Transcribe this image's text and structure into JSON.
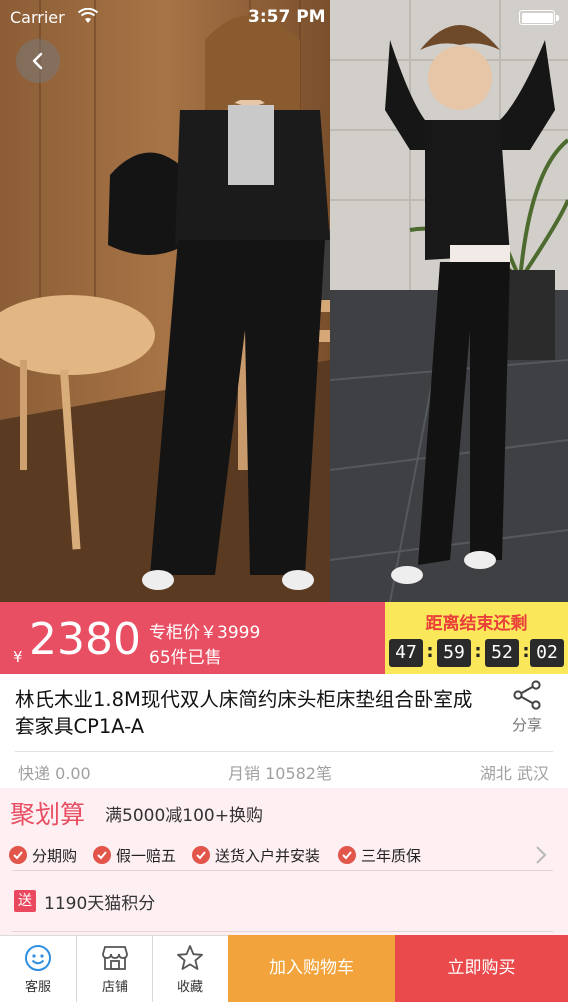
{
  "status_bar": {
    "carrier": "Carrier",
    "time": "3:57 PM"
  },
  "price_banner": {
    "currency": "¥",
    "price": "2380",
    "original_price": "专柜价￥3999",
    "sold": "65件已售",
    "countdown_title": "距离结束还剩",
    "countdown": [
      "47",
      "59",
      "52",
      "02"
    ]
  },
  "product": {
    "title": "林氏木业1.8M现代双人床简约床头柜床垫组合卧室成套家具CP1A-A",
    "share_label": "分享"
  },
  "shipping": {
    "fee": "快递 0.00",
    "monthly_sales": "月销 10582笔",
    "location": "湖北 武汉"
  },
  "promo": {
    "brand": "聚划算",
    "text": "满5000减100+换购",
    "features": [
      "分期购",
      "假一赔五",
      "送货入户并安装",
      "三年质保"
    ],
    "points_badge": "送",
    "points_text": "1190天猫积分"
  },
  "bottom_bar": {
    "tabs": [
      {
        "label": "客服",
        "icon": "customer-service-icon"
      },
      {
        "label": "店铺",
        "icon": "store-icon"
      },
      {
        "label": "收藏",
        "icon": "star-icon"
      }
    ],
    "add_to_cart": "加入购物车",
    "buy_now": "立即购买"
  },
  "colors": {
    "price_red": "#e94f63",
    "countdown_yellow": "#fbe75a",
    "cart_orange": "#f3a33c",
    "buy_red": "#ea4a4b",
    "promo_bg": "#fdeff2"
  }
}
